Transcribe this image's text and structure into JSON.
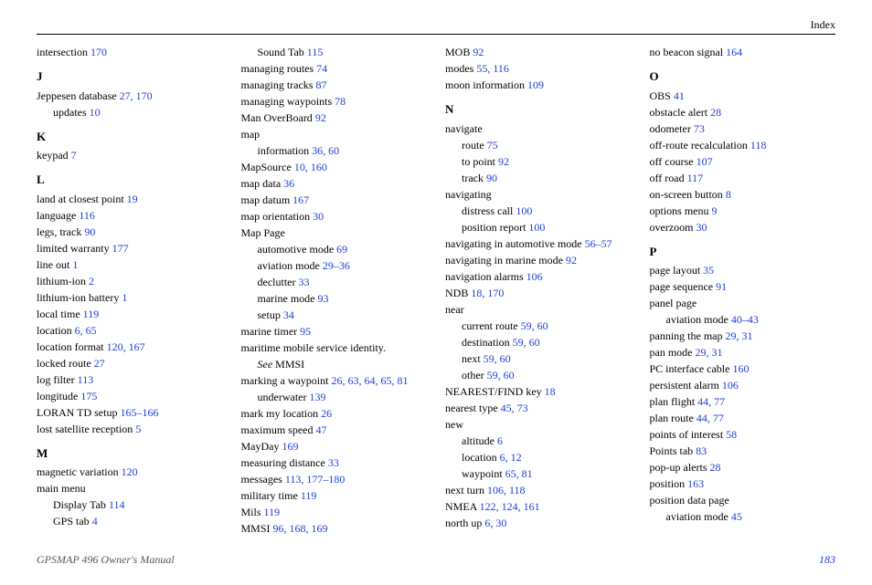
{
  "header": "Index",
  "footer_left": "GPSMAP 496 Owner's Manual",
  "footer_right": "183",
  "columns": [
    [
      {
        "t": "entry",
        "label": "intersection",
        "pages": "170"
      },
      {
        "t": "letter",
        "label": "J"
      },
      {
        "t": "entry",
        "label": "Jeppesen database",
        "pages": "27, 170"
      },
      {
        "t": "sub",
        "label": "updates",
        "pages": "10"
      },
      {
        "t": "letter",
        "label": "K"
      },
      {
        "t": "entry",
        "label": "keypad",
        "pages": "7"
      },
      {
        "t": "letter",
        "label": "L"
      },
      {
        "t": "entry",
        "label": "land at closest point",
        "pages": "19"
      },
      {
        "t": "entry",
        "label": "language",
        "pages": "116"
      },
      {
        "t": "entry",
        "label": "legs, track",
        "pages": "90"
      },
      {
        "t": "entry",
        "label": "limited warranty",
        "pages": "177"
      },
      {
        "t": "entry",
        "label": "line out",
        "pages": "1"
      },
      {
        "t": "entry",
        "label": "lithium-ion",
        "pages": "2"
      },
      {
        "t": "entry",
        "label": "lithium-ion battery",
        "pages": "1"
      },
      {
        "t": "entry",
        "label": "local time",
        "pages": "119"
      },
      {
        "t": "entry",
        "label": "location",
        "pages": "6, 65"
      },
      {
        "t": "entry",
        "label": "location format",
        "pages": "120, 167"
      },
      {
        "t": "entry",
        "label": "locked route",
        "pages": "27"
      },
      {
        "t": "entry",
        "label": "log filter",
        "pages": "113"
      },
      {
        "t": "entry",
        "label": "longitude",
        "pages": "175"
      },
      {
        "t": "entry",
        "label": "LORAN TD setup",
        "pages": "165–166"
      },
      {
        "t": "entry",
        "label": "lost satellite reception",
        "pages": "5"
      },
      {
        "t": "letter",
        "label": "M"
      },
      {
        "t": "entry",
        "label": "magnetic variation",
        "pages": "120"
      },
      {
        "t": "entry",
        "label": "main menu",
        "pages": ""
      },
      {
        "t": "sub",
        "label": "Display Tab",
        "pages": "114"
      },
      {
        "t": "sub",
        "label": "GPS tab",
        "pages": "4"
      }
    ],
    [
      {
        "t": "sub",
        "label": "Sound Tab",
        "pages": "115"
      },
      {
        "t": "entry",
        "label": "managing routes",
        "pages": "74"
      },
      {
        "t": "entry",
        "label": "managing tracks",
        "pages": "87"
      },
      {
        "t": "entry",
        "label": "managing waypoints",
        "pages": "78"
      },
      {
        "t": "entry",
        "label": "Man OverBoard",
        "pages": "92"
      },
      {
        "t": "entry",
        "label": "map",
        "pages": ""
      },
      {
        "t": "sub",
        "label": "information",
        "pages": "36, 60"
      },
      {
        "t": "entry",
        "label": "MapSource",
        "pages": "10, 160"
      },
      {
        "t": "entry",
        "label": "map data",
        "pages": "36"
      },
      {
        "t": "entry",
        "label": "map datum",
        "pages": "167"
      },
      {
        "t": "entry",
        "label": "map orientation",
        "pages": "30"
      },
      {
        "t": "entry",
        "label": "Map Page",
        "pages": ""
      },
      {
        "t": "sub",
        "label": "automotive mode",
        "pages": "69"
      },
      {
        "t": "sub",
        "label": "aviation mode",
        "pages": "29–36"
      },
      {
        "t": "sub",
        "label": "declutter",
        "pages": "33"
      },
      {
        "t": "sub",
        "label": "marine mode",
        "pages": "93"
      },
      {
        "t": "sub",
        "label": "setup",
        "pages": "34"
      },
      {
        "t": "entry",
        "label": "marine timer",
        "pages": "95"
      },
      {
        "t": "entry",
        "label": "maritime mobile service identity.",
        "pages": ""
      },
      {
        "t": "see",
        "label": "See",
        "extra": " MMSI"
      },
      {
        "t": "entry",
        "label": "marking a waypoint",
        "pages": "26, 63, 64, 65, 81"
      },
      {
        "t": "sub",
        "label": "underwater",
        "pages": "139"
      },
      {
        "t": "entry",
        "label": "mark my location",
        "pages": "26"
      },
      {
        "t": "entry",
        "label": "maximum speed",
        "pages": "47"
      },
      {
        "t": "entry",
        "label": "MayDay",
        "pages": "169"
      },
      {
        "t": "entry",
        "label": "measuring distance",
        "pages": "33"
      },
      {
        "t": "entry",
        "label": "messages",
        "pages": "113, 177–180"
      },
      {
        "t": "entry",
        "label": "military time",
        "pages": "119"
      },
      {
        "t": "entry",
        "label": "Mils",
        "pages": "119"
      },
      {
        "t": "entry",
        "label": "MMSI",
        "pages": "96, 168, 169"
      }
    ],
    [
      {
        "t": "entry",
        "label": "MOB",
        "pages": "92"
      },
      {
        "t": "entry",
        "label": "modes",
        "pages": "55, 116"
      },
      {
        "t": "entry",
        "label": "moon information",
        "pages": "109"
      },
      {
        "t": "letter",
        "label": "N"
      },
      {
        "t": "entry",
        "label": "navigate",
        "pages": ""
      },
      {
        "t": "sub",
        "label": "route",
        "pages": "75"
      },
      {
        "t": "sub",
        "label": "to point",
        "pages": "92"
      },
      {
        "t": "sub",
        "label": "track",
        "pages": "90"
      },
      {
        "t": "entry",
        "label": "navigating",
        "pages": ""
      },
      {
        "t": "sub",
        "label": "distress call",
        "pages": "100"
      },
      {
        "t": "sub",
        "label": "position report",
        "pages": "100"
      },
      {
        "t": "entry",
        "label": "navigating in automotive mode",
        "pages": "56–57"
      },
      {
        "t": "entry",
        "label": "navigating in marine mode",
        "pages": "92"
      },
      {
        "t": "entry",
        "label": "navigation alarms",
        "pages": "106"
      },
      {
        "t": "entry",
        "label": "NDB",
        "pages": "18, 170"
      },
      {
        "t": "entry",
        "label": "near",
        "pages": ""
      },
      {
        "t": "sub",
        "label": "current route",
        "pages": "59, 60"
      },
      {
        "t": "sub",
        "label": "destination",
        "pages": "59, 60"
      },
      {
        "t": "sub",
        "label": "next",
        "pages": "59, 60"
      },
      {
        "t": "sub",
        "label": "other",
        "pages": "59, 60"
      },
      {
        "t": "entry",
        "label": "NEAREST/FIND key",
        "pages": "18"
      },
      {
        "t": "entry",
        "label": "nearest type",
        "pages": "45, 73"
      },
      {
        "t": "entry",
        "label": "new",
        "pages": ""
      },
      {
        "t": "sub",
        "label": "altitude",
        "pages": "6"
      },
      {
        "t": "sub",
        "label": "location",
        "pages": "6, 12"
      },
      {
        "t": "sub",
        "label": "waypoint",
        "pages": "65, 81"
      },
      {
        "t": "entry",
        "label": "next turn",
        "pages": "106, 118"
      },
      {
        "t": "entry",
        "label": "NMEA",
        "pages": "122, 124, 161"
      },
      {
        "t": "entry",
        "label": "north up",
        "pages": "6, 30"
      }
    ],
    [
      {
        "t": "entry",
        "label": "no beacon signal",
        "pages": "164"
      },
      {
        "t": "letter",
        "label": "O"
      },
      {
        "t": "entry",
        "label": "OBS",
        "pages": "41"
      },
      {
        "t": "entry",
        "label": "obstacle alert",
        "pages": "28"
      },
      {
        "t": "entry",
        "label": "odometer",
        "pages": "73"
      },
      {
        "t": "entry",
        "label": "off-route recalculation",
        "pages": "118"
      },
      {
        "t": "entry",
        "label": "off course",
        "pages": "107"
      },
      {
        "t": "entry",
        "label": "off road",
        "pages": "117"
      },
      {
        "t": "entry",
        "label": "on-screen button",
        "pages": "8"
      },
      {
        "t": "entry",
        "label": "options menu",
        "pages": "9"
      },
      {
        "t": "entry",
        "label": "overzoom",
        "pages": "30"
      },
      {
        "t": "letter",
        "label": "P"
      },
      {
        "t": "entry",
        "label": "page layout",
        "pages": "35"
      },
      {
        "t": "entry",
        "label": "page sequence",
        "pages": "91"
      },
      {
        "t": "entry",
        "label": "panel page",
        "pages": ""
      },
      {
        "t": "sub",
        "label": "aviation mode",
        "pages": "40–43"
      },
      {
        "t": "entry",
        "label": "panning the map",
        "pages": "29, 31"
      },
      {
        "t": "entry",
        "label": "pan mode",
        "pages": "29, 31"
      },
      {
        "t": "entry",
        "label": "PC interface cable",
        "pages": "160"
      },
      {
        "t": "entry",
        "label": "persistent alarm",
        "pages": "106"
      },
      {
        "t": "entry",
        "label": "plan flight",
        "pages": "44, 77"
      },
      {
        "t": "entry",
        "label": "plan route",
        "pages": "44, 77"
      },
      {
        "t": "entry",
        "label": "points of interest",
        "pages": "58"
      },
      {
        "t": "entry",
        "label": "Points tab",
        "pages": "83"
      },
      {
        "t": "entry",
        "label": "pop-up alerts",
        "pages": "28"
      },
      {
        "t": "entry",
        "label": "position",
        "pages": "163"
      },
      {
        "t": "entry",
        "label": "position data page",
        "pages": ""
      },
      {
        "t": "sub",
        "label": "aviation mode",
        "pages": "45"
      }
    ]
  ]
}
